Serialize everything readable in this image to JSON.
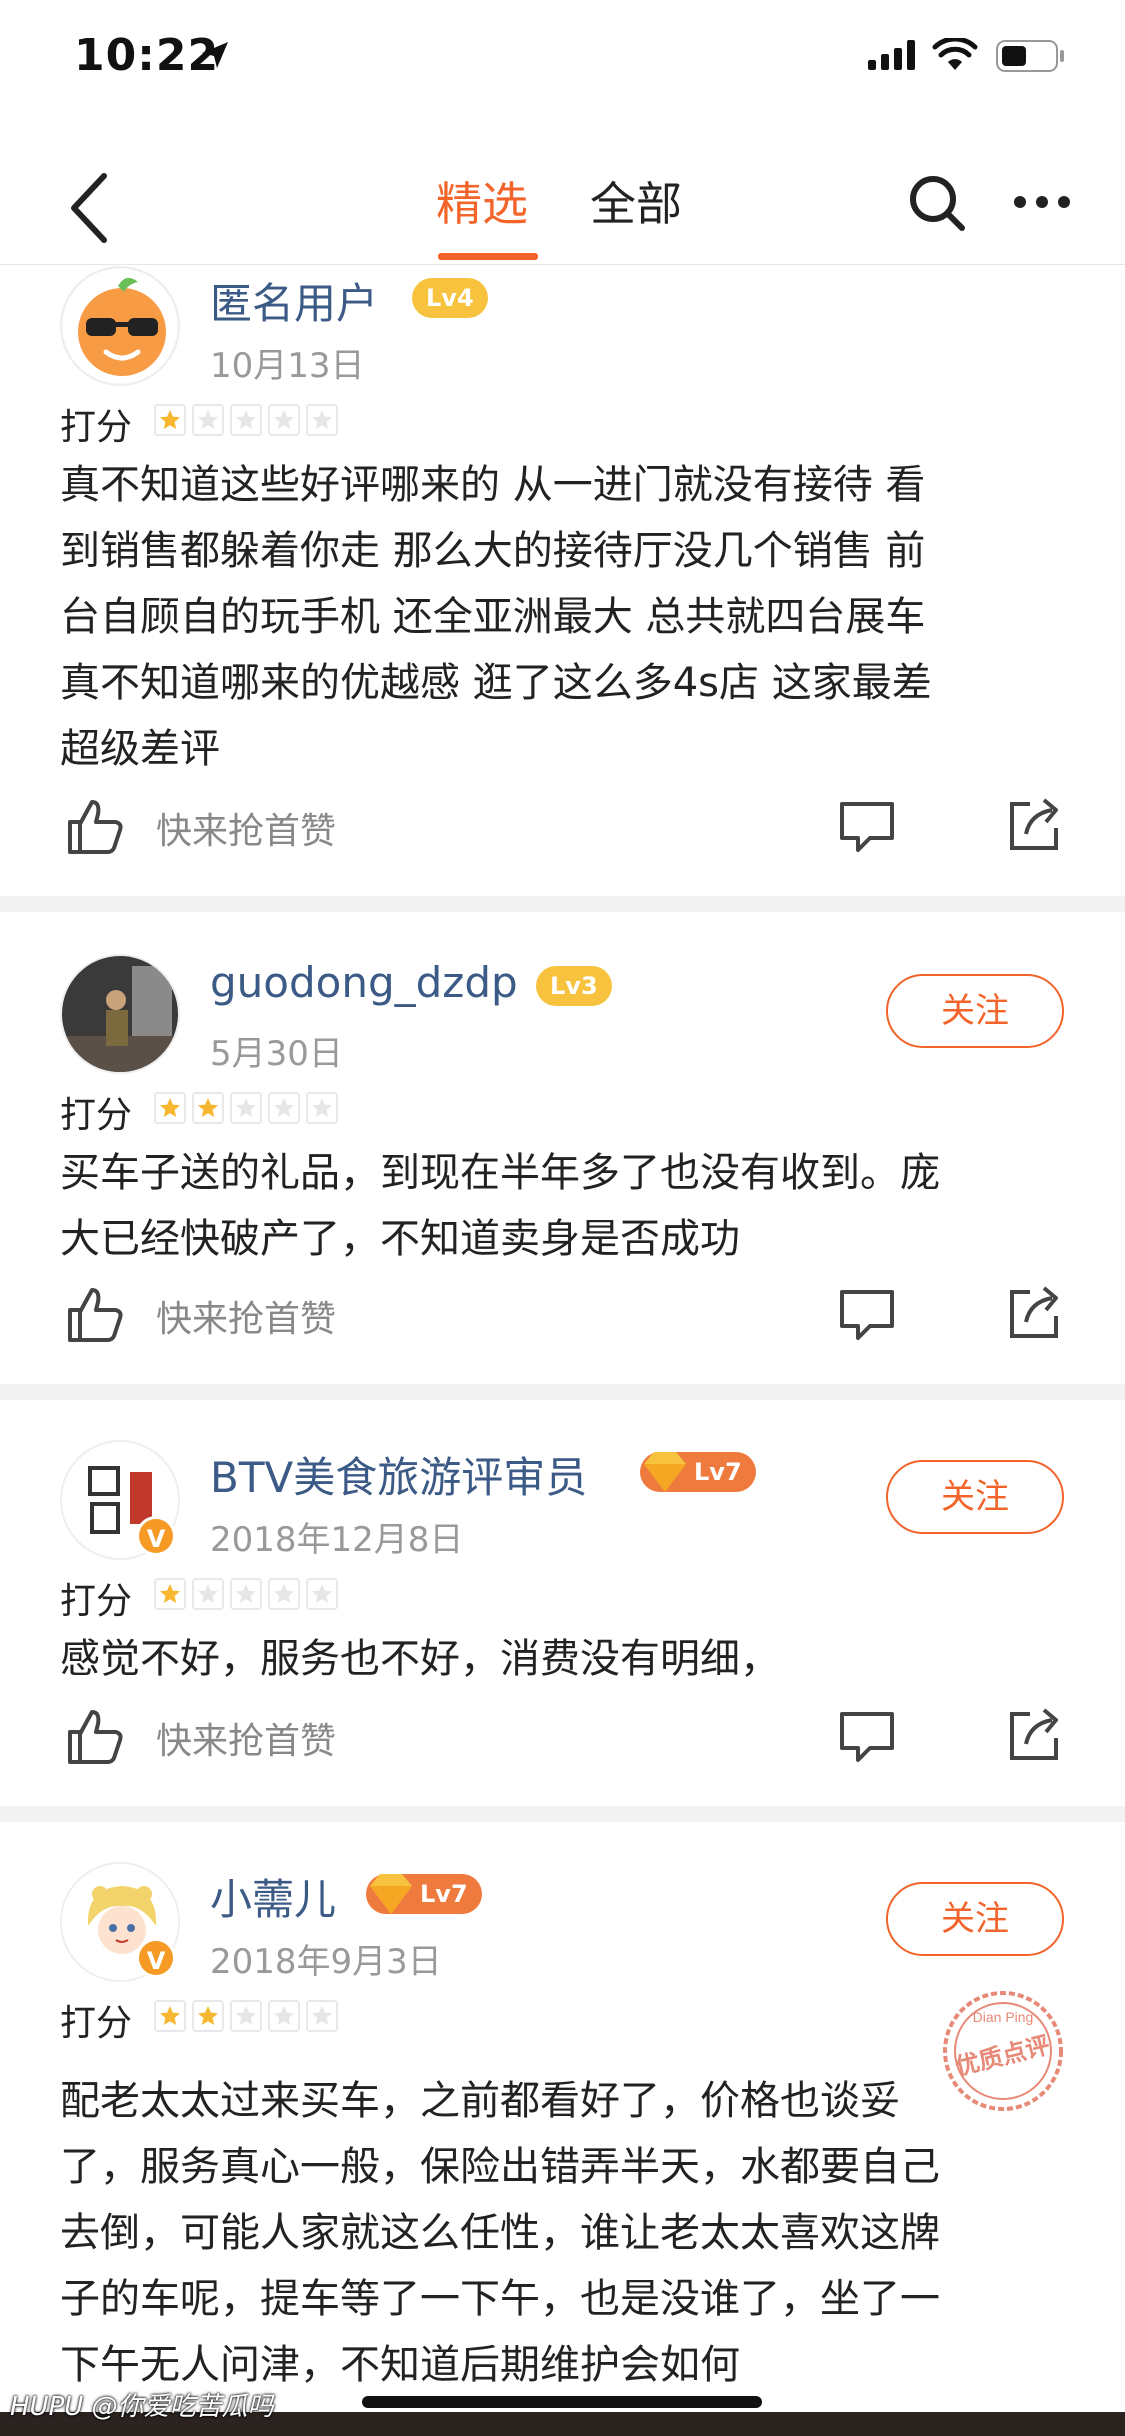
{
  "status_bar": {
    "time": "10:22"
  },
  "nav": {
    "tab_featured": "精选",
    "tab_all": "全部"
  },
  "rating_label": "打分",
  "like_prompt": "快来抢首赞",
  "reviews": [
    {
      "username": "匿名用户",
      "level": "Lv4",
      "date": "10月13日",
      "stars": 1,
      "text": "真不知道这些好评哪来的 从一进门就没有接待 看\n到销售都躲着你走 那么大的接待厅没几个销售 前\n台自顾自的玩手机 还全亚洲最大 总共就四台展车\n真不知道哪来的优越感 逛了这么多4s店 这家最差\n超级差评"
    },
    {
      "username": "guodong_dzdp",
      "level": "Lv3",
      "date": "5月30日",
      "stars": 2,
      "follow": "关注",
      "text": "买车子送的礼品，到现在半年多了也没有收到。庞\n大已经快破产了，不知道卖身是否成功"
    },
    {
      "username": "BTV美食旅游评审员",
      "level": "Lv7",
      "date": "2018年12月8日",
      "stars": 1,
      "follow": "关注",
      "verified": "V",
      "text": "感觉不好，服务也不好，消费没有明细，"
    },
    {
      "username": "小薷儿",
      "level": "Lv7",
      "date": "2018年9月3日",
      "stars": 2,
      "follow": "关注",
      "verified": "V",
      "text": "配老太太过来买车，之前都看好了，价格也谈妥\n了，服务真心一般，保险出错弄半天，水都要自己\n去倒，可能人家就这么任性，谁让老太太喜欢这牌\n子的车呢，提车等了一下午，也是没谁了，坐了一\n下午无人问津，不知道后期维护会如何"
    }
  ],
  "stamp": {
    "top": "Dian Ping",
    "main": "优质点评"
  },
  "watermark": "HUPU @你爱吃苦瓜吗",
  "colors": {
    "accent": "#f2642a",
    "username": "#3c5a86",
    "star_filled": "#f7b731"
  }
}
